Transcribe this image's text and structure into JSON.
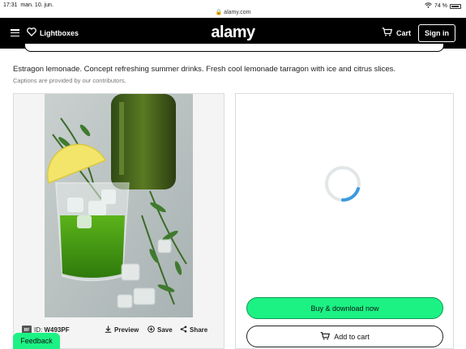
{
  "statusbar": {
    "time": "17:31",
    "date": "man. 10. jun.",
    "url": "alamy.com",
    "battery": "74 %"
  },
  "nav": {
    "lightboxes": "Lightboxes",
    "logo": "alamy",
    "cart": "Cart",
    "signin": "Sign in"
  },
  "image": {
    "caption": "Estragon lemonade. Concept refreshing summer drinks. Fresh cool lemonade tarragon with ice and citrus slices.",
    "caption_note": "Captions are provided by our contributors.",
    "license_badge": "RF",
    "id_label": "ID:",
    "id_value": "W493PF",
    "preview": "Preview",
    "save": "Save",
    "share": "Share"
  },
  "purchase": {
    "buy_label": "Buy & download now",
    "cart_label": "Add to cart"
  },
  "feedback": "Feedback",
  "colors": {
    "accent": "#1cf284",
    "navbar": "#000000",
    "spinner": "#3b9be0"
  }
}
